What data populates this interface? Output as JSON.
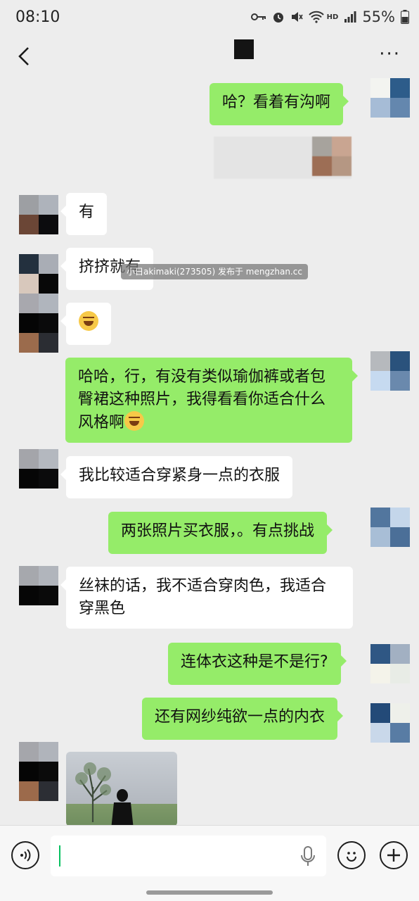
{
  "status_bar": {
    "time": "08:10",
    "network_badge": "HD",
    "battery_percent": "55%"
  },
  "nav": {
    "back_icon": "chevron-left-icon",
    "more_label": "···"
  },
  "watermark": "小日akimaki(273505) 发布于 mengzhan.cc",
  "messages": [
    {
      "dir": "out",
      "text": "哈？看着有沟啊"
    },
    {
      "dir": "in",
      "text": "有"
    },
    {
      "dir": "in",
      "text": "挤挤就有"
    },
    {
      "dir": "in",
      "text": ""
    },
    {
      "dir": "out",
      "text": "哈哈，行，有没有类似瑜伽裤或者包臀裙这种照片，我得看看你适合什么风格啊"
    },
    {
      "dir": "in",
      "text": "我比较适合穿紧身一点的衣服"
    },
    {
      "dir": "out",
      "text": "两张照片买衣服，。有点挑战"
    },
    {
      "dir": "in",
      "text": "丝袜的话，我不适合穿肉色，我适合穿黑色"
    },
    {
      "dir": "out",
      "text": "连体衣这种是不是行?"
    },
    {
      "dir": "out",
      "text": "还有网纱纯欲一点的内衣"
    }
  ],
  "input": {
    "value": "",
    "placeholder": ""
  },
  "colors": {
    "outgoing_bubble": "#95ec69",
    "incoming_bubble": "#ffffff",
    "background": "#ededed",
    "caret": "#07c160"
  }
}
